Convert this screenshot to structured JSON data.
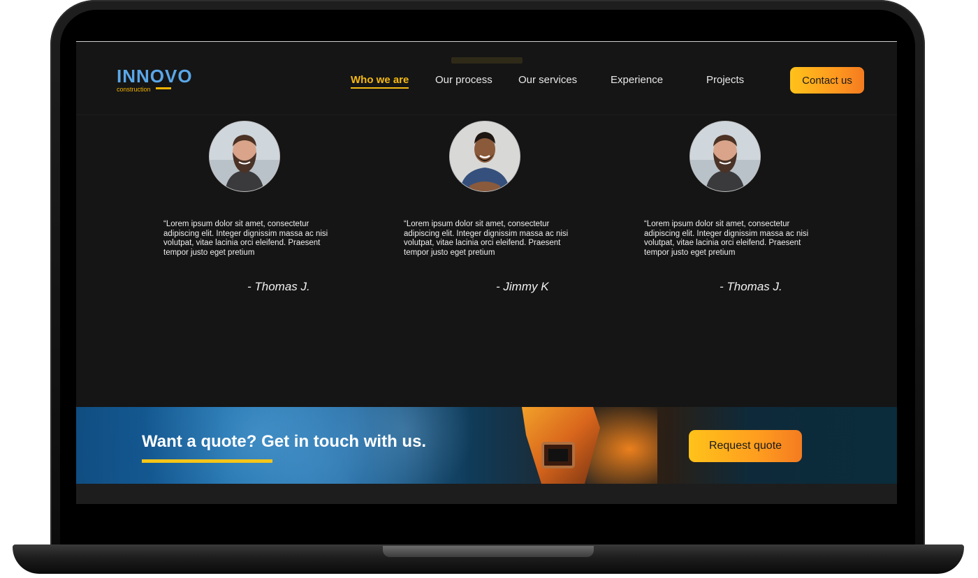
{
  "brand": {
    "name": "INNOVO",
    "tagline": "construction"
  },
  "nav": {
    "items": [
      {
        "label": "Who we are",
        "active": true
      },
      {
        "label": "Our process",
        "active": false
      },
      {
        "label": "Our services",
        "active": false
      },
      {
        "label": "Experience",
        "active": false
      },
      {
        "label": "Projects",
        "active": false
      }
    ],
    "contact_label": "Contact us"
  },
  "testimonials": [
    {
      "quote": "“Lorem ipsum dolor sit amet, consectetur adipiscing elit. Integer dignissim massa ac nisi volutpat, vitae lacinia orci eleifend. Praesent tempor justo eget pretium",
      "author": "- Thomas J.",
      "avatar": "bearded-man-avatar"
    },
    {
      "quote": "“Lorem ipsum dolor sit amet, consectetur adipiscing elit. Integer dignissim massa ac nisi volutpat, vitae lacinia orci eleifend. Praesent tempor justo eget pretium",
      "author": "- Jimmy K",
      "avatar": "smiling-man-avatar"
    },
    {
      "quote": "“Lorem ipsum dolor sit amet, consectetur adipiscing elit. Integer dignissim massa ac nisi volutpat, vitae lacinia orci eleifend. Praesent tempor justo eget pretium",
      "author": "- Thomas J.",
      "avatar": "bearded-man-avatar"
    }
  ],
  "cta": {
    "heading": "Want a quote? Get in touch with us.",
    "button_label": "Request quote"
  },
  "colors": {
    "accent": "#f5b913",
    "logo_blue": "#5aa7e8",
    "background": "#151515"
  }
}
